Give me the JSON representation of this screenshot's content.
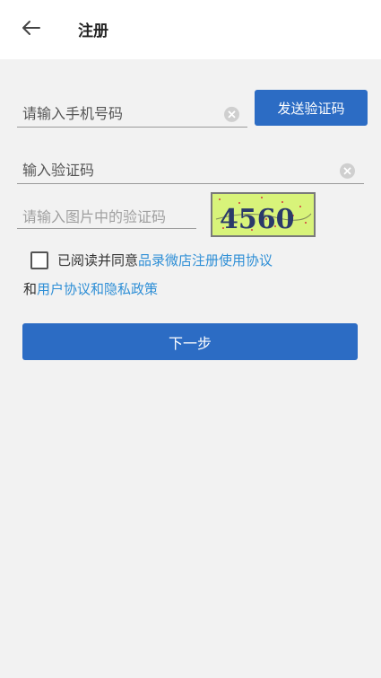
{
  "header": {
    "title": "注册",
    "back_icon": "arrow-left-icon"
  },
  "form": {
    "phone_placeholder": "请输入手机号码",
    "send_code_label": "发送验证码",
    "sms_code_placeholder": "输入验证码",
    "captcha_placeholder": "请输入图片中的验证码",
    "captcha_text": "4560"
  },
  "agreement": {
    "prefix": "已阅读并同意",
    "store_agreement_link": "品录微店注册使用协议",
    "and_text": "和",
    "privacy_link": "用户协议和隐私政策"
  },
  "next_label": "下一步",
  "colors": {
    "primary": "#2c6cc4",
    "link": "#2f8fd6",
    "captcha_bg": "#d8f37a"
  }
}
